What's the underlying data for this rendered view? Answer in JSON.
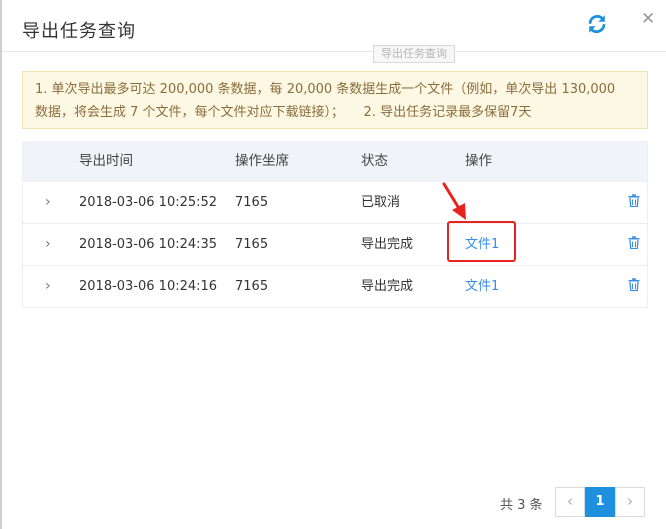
{
  "dialog": {
    "title": "导出任务查询",
    "close_glyph": "✕"
  },
  "watermark": "导出任务查询",
  "notice": {
    "line1": "1. 单次导出最多可达 200,000 条数据，每 20,000 条数据生成一个文件（例如，单次导出 130,000",
    "line2": "数据，将会生成 7 个文件，每个文件对应下载链接）；　　2. 导出任务记录最多保留7天"
  },
  "table": {
    "columns": [
      "导出时间",
      "操作坐席",
      "状态",
      "操作"
    ],
    "rows": [
      {
        "time": "2018-03-06 10:25:52",
        "agent": "7165",
        "status": "已取消",
        "action": ""
      },
      {
        "time": "2018-03-06 10:24:35",
        "agent": "7165",
        "status": "导出完成",
        "action": "文件1"
      },
      {
        "time": "2018-03-06 10:24:16",
        "agent": "7165",
        "status": "导出完成",
        "action": "文件1"
      }
    ],
    "expand_glyph": "›"
  },
  "pagination": {
    "total": "共 3 条",
    "prev": "‹",
    "current": "1",
    "next": "›"
  },
  "colors": {
    "accent": "#1e90dd",
    "link": "#3a8ee6",
    "annotation": "#e8231d",
    "notice_bg": "#fdf8e4"
  }
}
